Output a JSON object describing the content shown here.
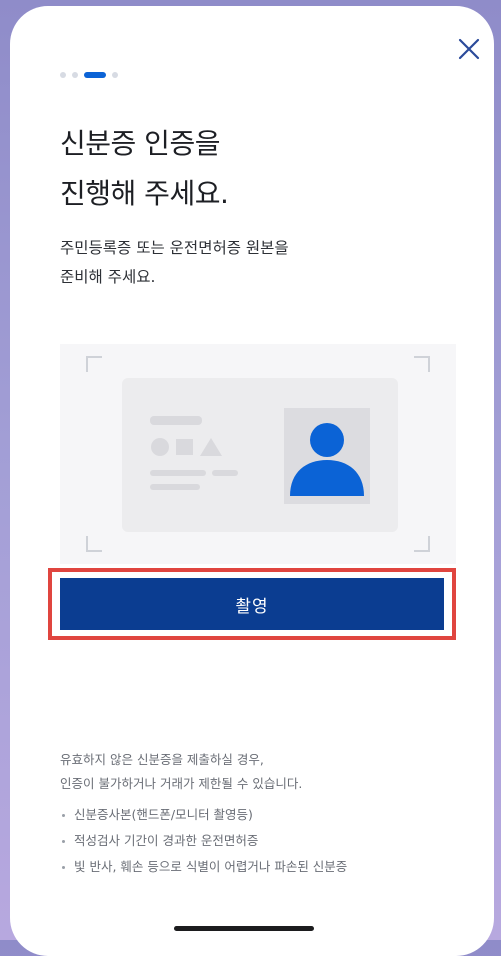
{
  "header": {
    "close_icon": "close-icon",
    "steps": {
      "total": 4,
      "current": 3
    }
  },
  "title": {
    "line1": "신분증 인증을",
    "line2": "진행해 주세요."
  },
  "subtitle": {
    "line1": "주민등록증 또는 운전면허증 원본을",
    "line2": "준비해 주세요."
  },
  "illustration": {
    "icon": "id-card-illustration",
    "accent_color": "#0b63d6"
  },
  "capture_button": {
    "label": "촬영",
    "color": "#0b3d91",
    "highlight_color": "#e0453f"
  },
  "notice": {
    "line1": "유효하지 않은 신분증을 제출하실 경우,",
    "line2": "인증이 불가하거나 거래가 제한될 수 있습니다.",
    "items": [
      "신분증사본(핸드폰/모니터 촬영등)",
      "적성검사 기간이 경과한 운전면허증",
      "빛 반사, 훼손 등으로 식별이 어렵거나 파손된 신분증"
    ]
  }
}
